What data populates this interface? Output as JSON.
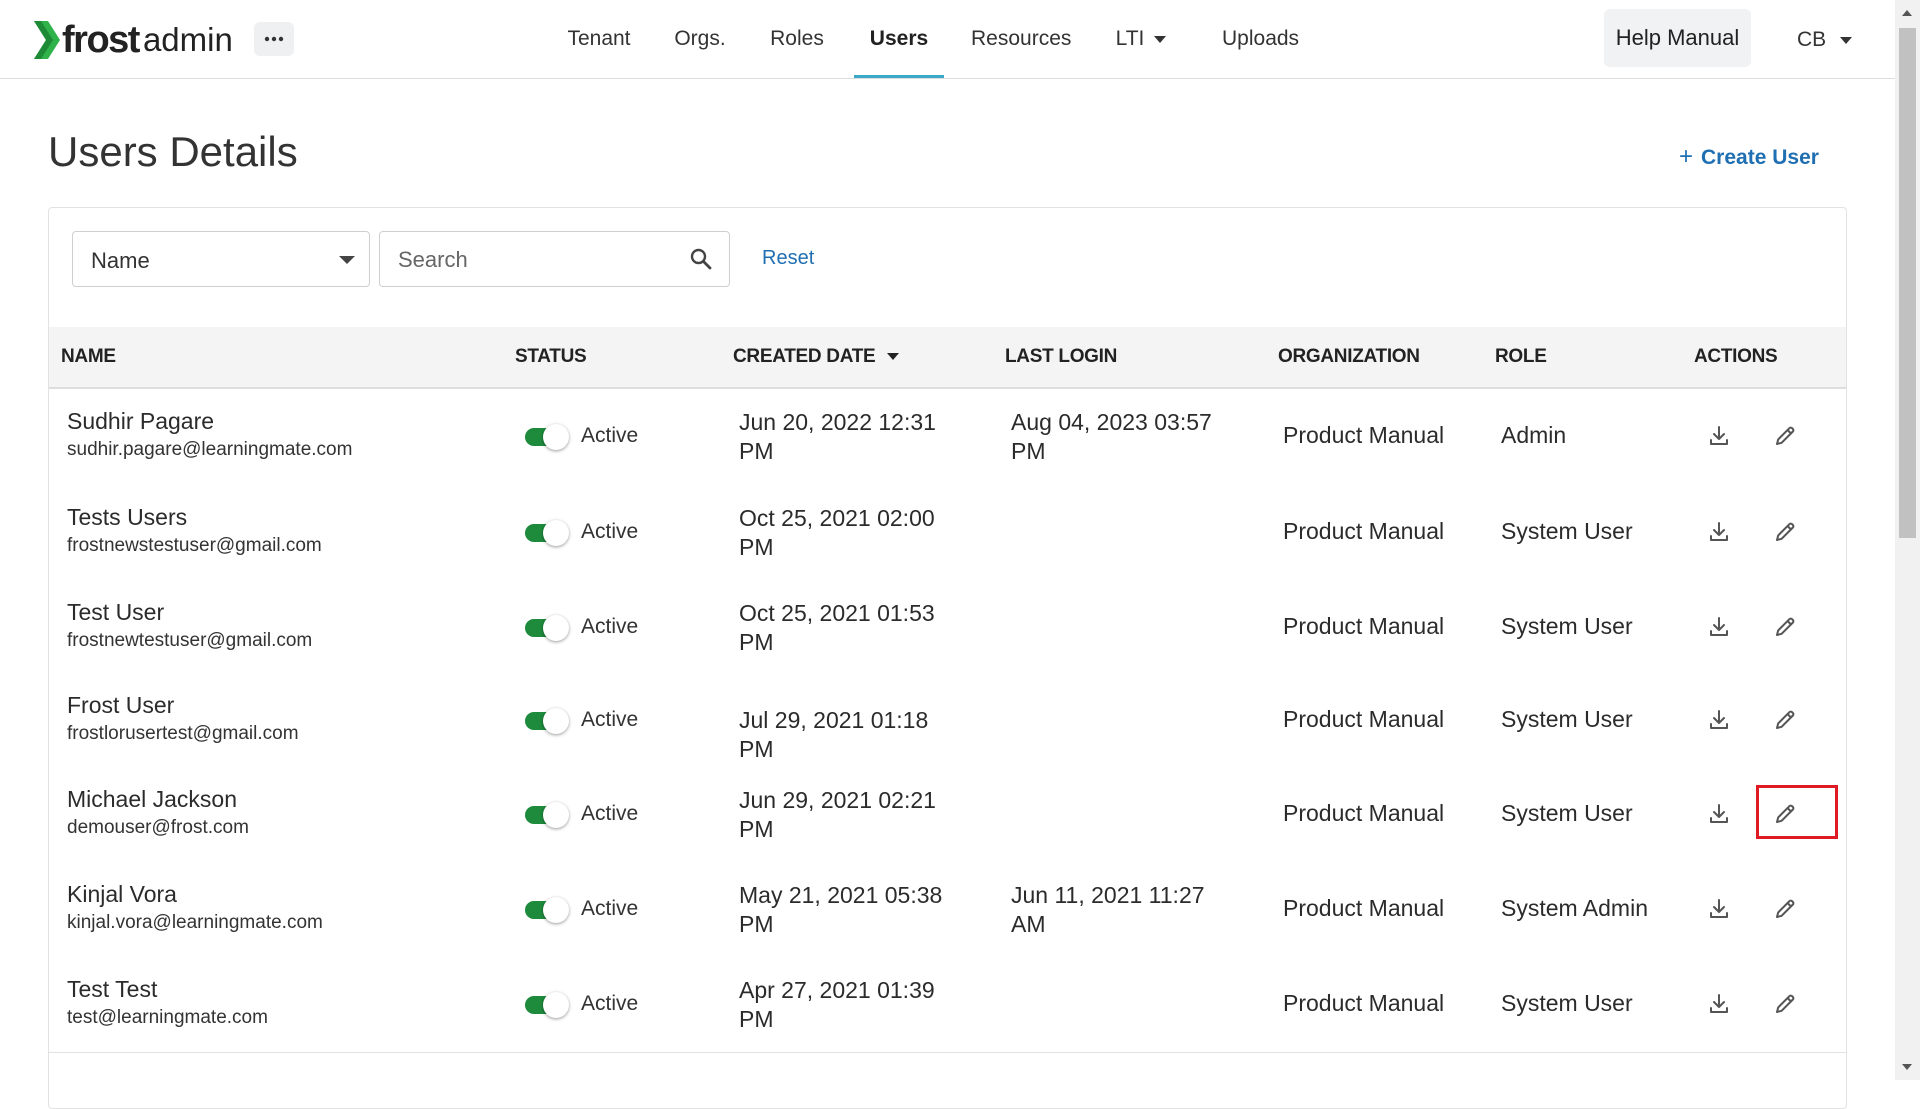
{
  "app": {
    "brand_bold": "frost",
    "brand_light": "admin",
    "more_label": "···"
  },
  "nav": {
    "items": [
      {
        "label": "Tenant"
      },
      {
        "label": "Orgs."
      },
      {
        "label": "Roles"
      },
      {
        "label": "Users",
        "active": true
      },
      {
        "label": "Resources"
      },
      {
        "label": "LTI",
        "has_dropdown": true
      },
      {
        "label": "Uploads"
      }
    ],
    "help_label": "Help Manual",
    "user_initials": "CB"
  },
  "page": {
    "title": "Users Details",
    "create_label": "Create User"
  },
  "filters": {
    "field_value": "Name",
    "search_placeholder": "Search",
    "search_value": "",
    "reset_label": "Reset"
  },
  "table": {
    "columns": [
      "NAME",
      "STATUS",
      "CREATED DATE",
      "LAST LOGIN",
      "ORGANIZATION",
      "ROLE",
      "ACTIONS"
    ],
    "sorted_column": "CREATED DATE",
    "rows": [
      {
        "name": "Sudhir Pagare",
        "email": "sudhir.pagare@learningmate.com",
        "status": "Active",
        "created_l1": "Jun 20, 2022 12:31",
        "created_l2": "PM",
        "login_l1": "Aug 04, 2023 03:57",
        "login_l2": "PM",
        "org": "Product Manual",
        "role": "Admin"
      },
      {
        "name": "Tests Users",
        "email": "frostnewstestuser@gmail.com",
        "status": "Active",
        "created_l1": "Oct 25, 2021 02:00",
        "created_l2": "PM",
        "login_l1": "",
        "login_l2": "",
        "org": "Product Manual",
        "role": "System User"
      },
      {
        "name": "Test User",
        "email": "frostnewtestuser@gmail.com",
        "status": "Active",
        "created_l1": "Oct 25, 2021 01:53",
        "created_l2": "PM",
        "login_l1": "",
        "login_l2": "",
        "org": "Product Manual",
        "role": "System User"
      },
      {
        "name": "Frost User",
        "email": "frostlorusertest@gmail.com",
        "status": "Active",
        "created_l1": "Jul 29, 2021 01:18 PM",
        "created_l2": "",
        "login_l1": "",
        "login_l2": "",
        "org": "Product Manual",
        "role": "System User"
      },
      {
        "name": "Michael Jackson",
        "email": "demouser@frost.com",
        "status": "Active",
        "created_l1": "Jun 29, 2021 02:21",
        "created_l2": "PM",
        "login_l1": "",
        "login_l2": "",
        "org": "Product Manual",
        "role": "System User"
      },
      {
        "name": "Kinjal Vora",
        "email": "kinjal.vora@learningmate.com",
        "status": "Active",
        "created_l1": "May 21, 2021 05:38",
        "created_l2": "PM",
        "login_l1": "Jun 11, 2021 11:27",
        "login_l2": "AM",
        "org": "Product Manual",
        "role": "System Admin"
      },
      {
        "name": "Test Test",
        "email": "test@learningmate.com",
        "status": "Active",
        "created_l1": "Apr 27, 2021 01:39",
        "created_l2": "PM",
        "login_l1": "",
        "login_l2": "",
        "org": "Product Manual",
        "role": "System User"
      }
    ]
  },
  "colors": {
    "accent_underline": "#39a9c7",
    "link": "#1f6fb2",
    "toggle_on": "#1e8a3c",
    "highlight": "#e01a22",
    "logo_green": "#2fb24a"
  },
  "icons": [
    "more-icon",
    "chevron-down-icon",
    "search-icon",
    "plus-icon",
    "download-icon",
    "edit-pencil-icon"
  ]
}
